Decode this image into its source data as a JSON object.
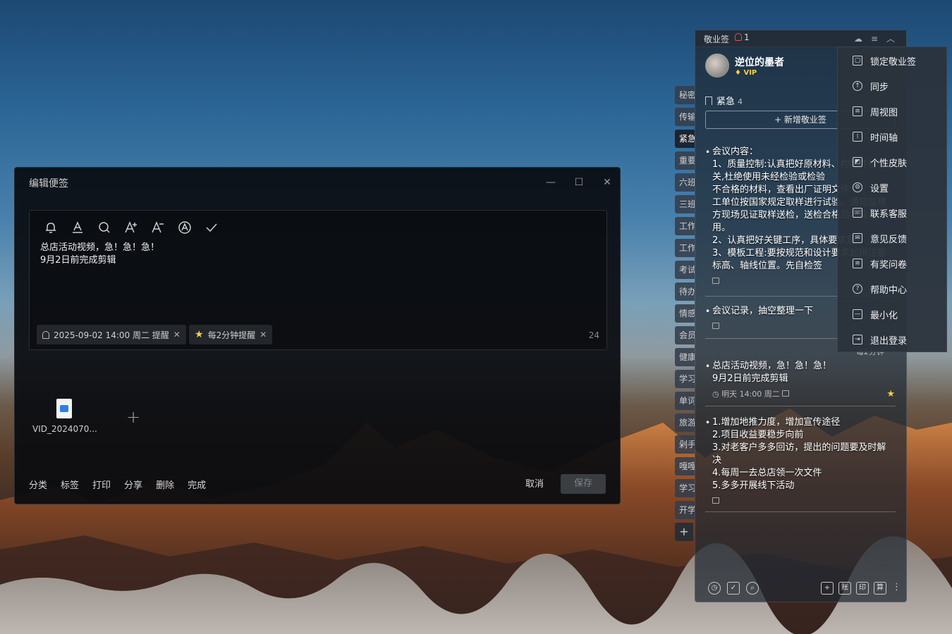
{
  "editor": {
    "title": "编辑便签",
    "window_controls": {
      "minimize": "—",
      "maximize": "☐",
      "close": "✕"
    },
    "toolbar": [
      "bell-icon",
      "font-color-icon",
      "search-icon",
      "font-increase-icon",
      "font-decrease-icon",
      "text-style-icon",
      "check-icon"
    ],
    "note_line1": "总店活动视频，急！急！急！",
    "note_line2": "9月2日前完成剪辑",
    "reminder_chip": "2025-09-02 14:00 周二 提醒",
    "repeat_chip": "每2分钟提醒",
    "char_count": "24",
    "attachment_name": "VID_2024070...",
    "footer": {
      "classify": "分类",
      "tag": "标签",
      "print": "打印",
      "share": "分享",
      "delete": "删除",
      "done": "完成",
      "cancel": "取消",
      "save": "保存"
    }
  },
  "sidetabs": [
    "秘密",
    "传输",
    "紧急",
    "重要",
    "六班",
    "三班",
    "工作",
    "工作",
    "考试",
    "待办",
    "情感",
    "会员",
    "健康",
    "学习",
    "单词",
    "旅游",
    "剁手",
    "嘎嘎",
    "学习",
    "开学",
    "+"
  ],
  "panel": {
    "app_name": "敬业签",
    "reminder_count": "1",
    "user_name": "逆位的墨者",
    "vip": "VIP",
    "category": "紧急",
    "category_count": "4",
    "new_note": "+ 新增敬业签",
    "notes": [
      {
        "lines": [
          "会议内容：",
          "1、质量控制:认真把好原材料、构配件检验",
          "关,杜绝使用未经检验或检验",
          "不合格的材料，查看出厂证明文件",
          "工单位按国家规定取样进行试验。通知监理",
          "方现场见证取样送检，送检合格后才能使",
          "用。",
          "2、认真把好关键工序，具体要求是：",
          "3、模板工程:要按规范和设计要求起拱注意",
          "标高、轴线位置。先自检签"
        ]
      },
      {
        "lines": [
          "会议记录，抽空整理一下"
        ]
      },
      {
        "lines": [
          "总店活动视频，急！急！急！",
          "9月2日前完成剪辑"
        ],
        "meta": "明天 14:00 周二",
        "top_meta": "每2分钟"
      },
      {
        "lines": [
          "1.增加地推力度，增加宣传途径",
          "2.项目收益要稳步向前",
          "3.对老客户多多回访，提出的问题要及时解",
          "决",
          "4.每周一去总店领一次文件",
          "5.多多开展线下活动"
        ]
      }
    ]
  },
  "menu": {
    "items": [
      {
        "label": "锁定敬业签",
        "icon": "lock-icon"
      },
      {
        "label": "同步",
        "icon": "sync-icon"
      },
      {
        "label": "周视图",
        "icon": "week-view-icon"
      },
      {
        "label": "时间轴",
        "icon": "timeline-icon"
      },
      {
        "label": "个性皮肤",
        "icon": "skin-icon"
      },
      {
        "label": "设置",
        "icon": "settings-icon"
      },
      {
        "label": "联系客服",
        "icon": "support-icon"
      },
      {
        "label": "意见反馈",
        "icon": "feedback-icon"
      },
      {
        "label": "有奖问卷",
        "icon": "survey-icon"
      },
      {
        "label": "帮助中心",
        "icon": "help-icon"
      },
      {
        "label": "最小化",
        "icon": "minimize-icon"
      },
      {
        "label": "退出登录",
        "icon": "logout-icon"
      }
    ]
  },
  "bottombar": {
    "add": "+",
    "account": "账",
    "print": "印",
    "calc": "算"
  },
  "colors": {
    "accent_star": "#f4d13d",
    "vip": "#f4d13d",
    "bell_badge": "#e05050"
  }
}
